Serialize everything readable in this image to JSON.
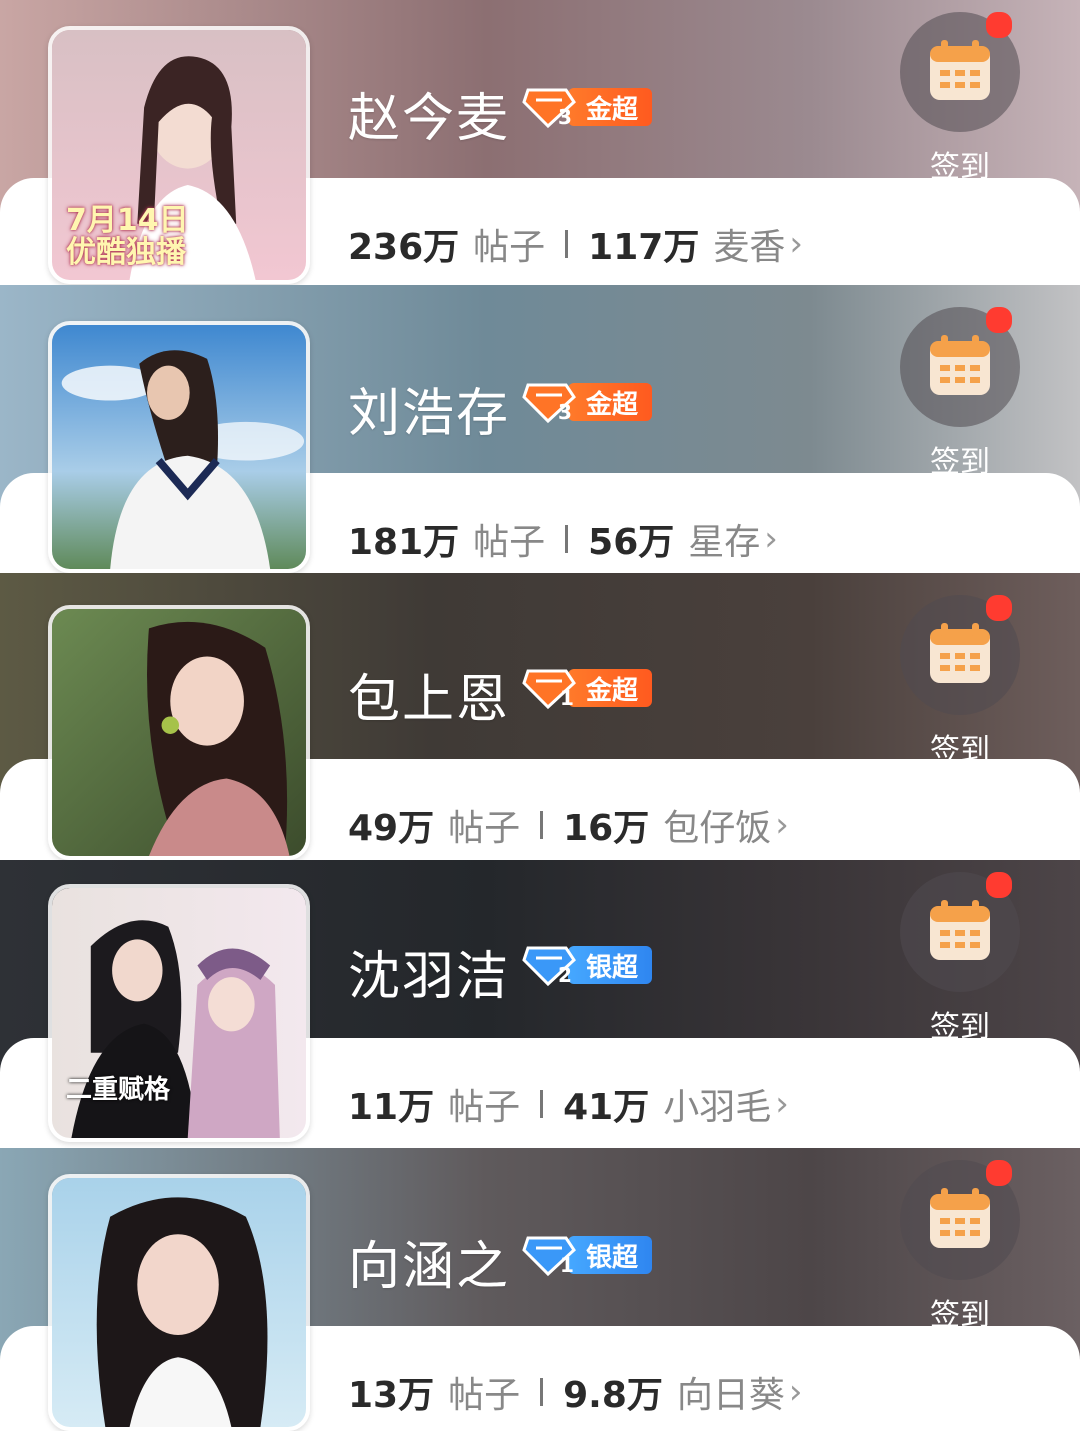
{
  "colors": {
    "gold_badge": "#ff6a24",
    "silver_badge": "#3a98f8",
    "checkin_dot": "#ff3b30",
    "checkin_icon": "#f5a14a"
  },
  "checkin_label": "签到",
  "cards": [
    {
      "name": "赵今麦",
      "badge_level": "3",
      "badge_label": "金超",
      "badge_tier": "gold",
      "posts": "236万",
      "posts_label": "帖子",
      "fans": "117万",
      "fan_name": "麦香",
      "cover_caption_1": "7月14日",
      "cover_caption_2": "优酷独播",
      "icon": "calendar-icon"
    },
    {
      "name": "刘浩存",
      "badge_level": "3",
      "badge_label": "金超",
      "badge_tier": "gold",
      "posts": "181万",
      "posts_label": "帖子",
      "fans": "56万",
      "fan_name": "星存",
      "icon": "calendar-icon"
    },
    {
      "name": "包上恩",
      "badge_level": "1",
      "badge_label": "金超",
      "badge_tier": "gold",
      "posts": "49万",
      "posts_label": "帖子",
      "fans": "16万",
      "fan_name": "包仔饭",
      "icon": "calendar-icon"
    },
    {
      "name": "沈羽洁",
      "badge_level": "2",
      "badge_label": "银超",
      "badge_tier": "silver",
      "posts": "11万",
      "posts_label": "帖子",
      "fans": "41万",
      "fan_name": "小羽毛",
      "cover_caption_1": "二重赋格",
      "icon": "calendar-icon"
    },
    {
      "name": "向涵之",
      "badge_level": "1",
      "badge_label": "银超",
      "badge_tier": "silver",
      "posts": "13万",
      "posts_label": "帖子",
      "fans": "9.8万",
      "fan_name": "向日葵",
      "icon": "calendar-icon"
    }
  ]
}
